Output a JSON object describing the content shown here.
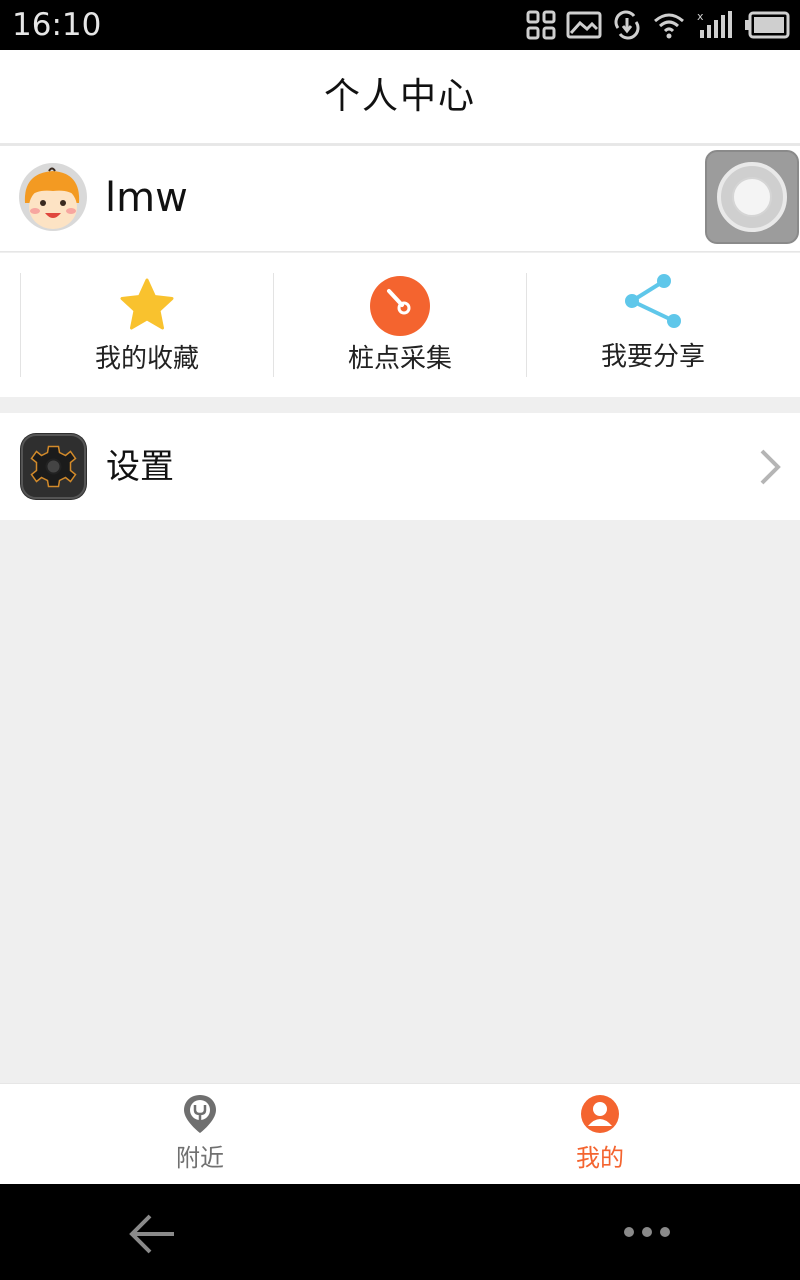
{
  "status_bar": {
    "time": "16:10"
  },
  "header": {
    "title": "个人中心"
  },
  "profile": {
    "username": "lmw"
  },
  "actions": [
    {
      "label": "我的收藏",
      "icon": "star-icon",
      "color": "#f9c22e"
    },
    {
      "label": "桩点采集",
      "icon": "gauge-icon",
      "color": "#f4642f"
    },
    {
      "label": "我要分享",
      "icon": "share-icon",
      "color": "#5fc7ea"
    }
  ],
  "settings": {
    "label": "设置",
    "icon": "gear-icon"
  },
  "tabs": [
    {
      "label": "附近",
      "icon": "location-pin-icon",
      "active": false,
      "color": "#707070"
    },
    {
      "label": "我的",
      "icon": "user-icon",
      "active": true,
      "color": "#f4642f"
    }
  ],
  "colors": {
    "accent": "#f4642f",
    "background": "#efefef"
  }
}
